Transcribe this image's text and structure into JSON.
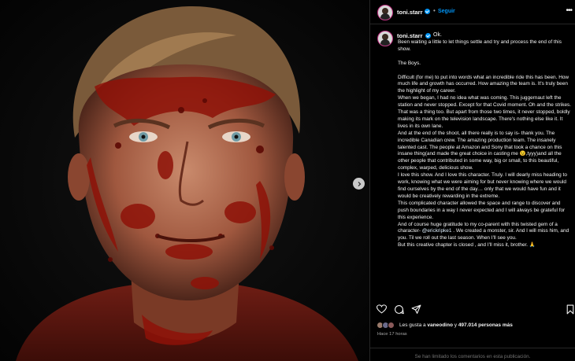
{
  "header": {
    "username": "toni.starr",
    "separator": "•",
    "follow_label": "Seguir",
    "more_label": "•••"
  },
  "caption": {
    "username": "toni.starr",
    "first_line": "Ok.",
    "lines": [
      "Been waiting a little to let things settle and try and process the end of this show.",
      "",
      "The Boys.",
      "",
      "Difficult (for me) to put into words what an incredible ride this has been. How much life and growth has occurred. How amazing the team is. It's truly been the highlight of my career.",
      "When we began, I had no idea what was coming. This juggernaut left the station and never stopped. Except for that Covid moment. Oh and the strikes. That was a thing too. But apart from those two times, it never stopped, boldly making its mark on the television landscape. There's nothing else like it. It lives in its own lane.",
      "And at the end of the shoot, all there really is to say is- thank you. The incredible Canadian crew. The amazing production team. The insanely talented cast. The people at Amazon and Sony that took a chance on this insane thing(and made the great choice in casting me 😉,tyyy)and all the other people that contributed in some way, big or small, to this beautiful, complex, warped, delicious show.",
      "I love this show. And I love this character. Truly. I will dearly miss heading to work, knowing what we were aiming for but never knowing where we would find ourselves by the end of the day… only that we would have fun and it would be creatively rewarding in the extreme.",
      "This complicated character allowed the space and range to discover and push boundaries in a way I never expected and I will always be grateful for this experience."
    ],
    "gratitude_before": "And of course huge gratitude to my co-parent with this twisted gem of a character- ",
    "mention": "@erickripke1",
    "gratitude_after": " . We created a monster, sir. And I will miss him, and you. Til we roll out the last season. When I'll see you.",
    "closing": "But this creative chapter is closed , and I'll miss it, brother. 🙏"
  },
  "likes": {
    "prefix": "Les gusta a ",
    "user": "vaneodino",
    "middle": " y ",
    "count": "497.014 personas más"
  },
  "timestamp": "Hace 17 horas",
  "footer": "Se han limitado los comentarios en esta publicación.",
  "icons": {
    "like": "heart-icon",
    "comment": "comment-icon",
    "share": "share-icon",
    "save": "bookmark-icon",
    "next": "chevron-right-icon"
  },
  "colors": {
    "accent": "#0095f6",
    "background": "#000000",
    "text": "#f5f5f5",
    "muted": "#a8a8a8"
  }
}
